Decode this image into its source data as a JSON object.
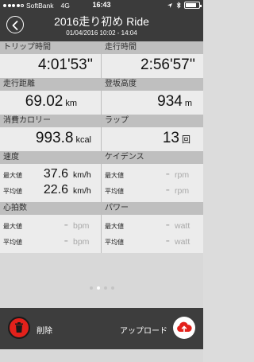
{
  "status": {
    "carrier": "SoftBank",
    "network": "4G",
    "time": "16:43",
    "battery_level": 0.82
  },
  "header": {
    "title": "2016走り初め Ride",
    "subtitle": "01/04/2016 10:02 - 14:04"
  },
  "stats": {
    "trip_time": {
      "label": "トリップ時間",
      "value": "4:01'53''"
    },
    "moving_time": {
      "label": "走行時間",
      "value": "2:56'57''"
    },
    "distance": {
      "label": "走行距離",
      "value": "69.02",
      "unit": "km"
    },
    "elevation": {
      "label": "登坂高度",
      "value": "934",
      "unit": "m"
    },
    "calories": {
      "label": "消費カロリー",
      "value": "993.8",
      "unit": "kcal"
    },
    "laps": {
      "label": "ラップ",
      "value": "13",
      "unit": "回"
    },
    "speed": {
      "label": "速度",
      "max_label": "最大値",
      "max": "37.6",
      "avg_label": "平均値",
      "avg": "22.6",
      "unit": "km/h"
    },
    "cadence": {
      "label": "ケイデンス",
      "max_label": "最大値",
      "max": "-",
      "avg_label": "平均値",
      "avg": "-",
      "unit": "rpm"
    },
    "heart_rate": {
      "label": "心拍数",
      "max_label": "最大値",
      "max": "-",
      "avg_label": "平均値",
      "avg": "-",
      "unit": "bpm"
    },
    "power": {
      "label": "パワー",
      "max_label": "最大値",
      "max": "-",
      "avg_label": "平均値",
      "avg": "-",
      "unit": "watt"
    }
  },
  "pager": {
    "count": 4,
    "active": 1
  },
  "actions": {
    "delete_label": "削除",
    "upload_label": "アップロード"
  },
  "colors": {
    "header_bg": "#3b3b3b",
    "delete_red": "#e3211b",
    "upload_red": "#e3211b"
  }
}
